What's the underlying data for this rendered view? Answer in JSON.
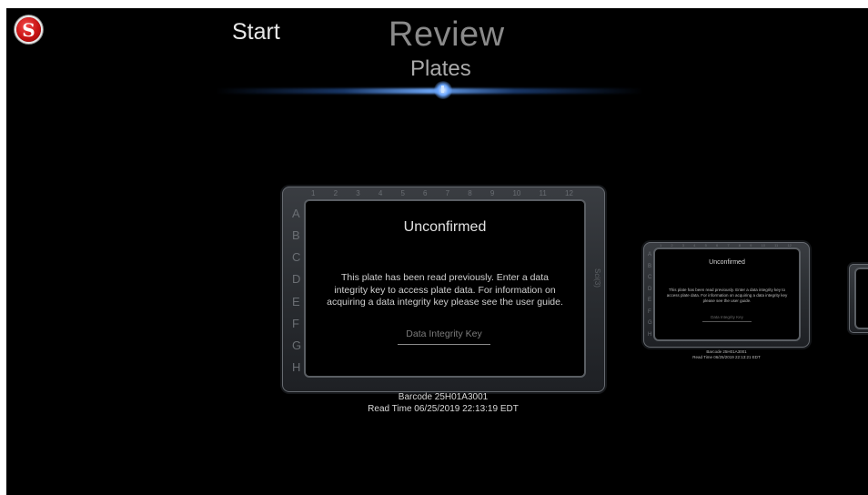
{
  "header": {
    "logo_letter": "S",
    "nav": {
      "start": "Start",
      "review": "Review",
      "plates": "Plates"
    }
  },
  "plate_grid": {
    "columns": [
      "1",
      "2",
      "3",
      "4",
      "5",
      "6",
      "7",
      "8",
      "9",
      "10",
      "11",
      "12"
    ],
    "rows": [
      "A",
      "B",
      "C",
      "D",
      "E",
      "F",
      "G",
      "H"
    ],
    "side_label": "Sci(3)"
  },
  "main_plate": {
    "status": "Unconfirmed",
    "message": "This plate has been read previously. Enter a data integrity key to access plate data. For information on acquiring a data integrity key please see the user guide.",
    "key_placeholder": "Data Integrity Key",
    "barcode": "Barcode 25H01A3001",
    "read_time": "Read Time 06/25/2019 22:13:19 EDT"
  },
  "secondary_plate": {
    "status": "Unconfirmed",
    "message": "This plate has been read previously. Enter a data integrity key to access plate data. For information on acquiring a data integrity key please see the user guide.",
    "key_placeholder": "Data Integrity Key",
    "barcode": "Barcode 25H01A3001",
    "read_time": "Read Time 06/25/2019 22:13:21 EDT"
  },
  "colors": {
    "background": "#000000",
    "logo_red": "#c91414",
    "glow_blue": "#6aa6ff"
  }
}
